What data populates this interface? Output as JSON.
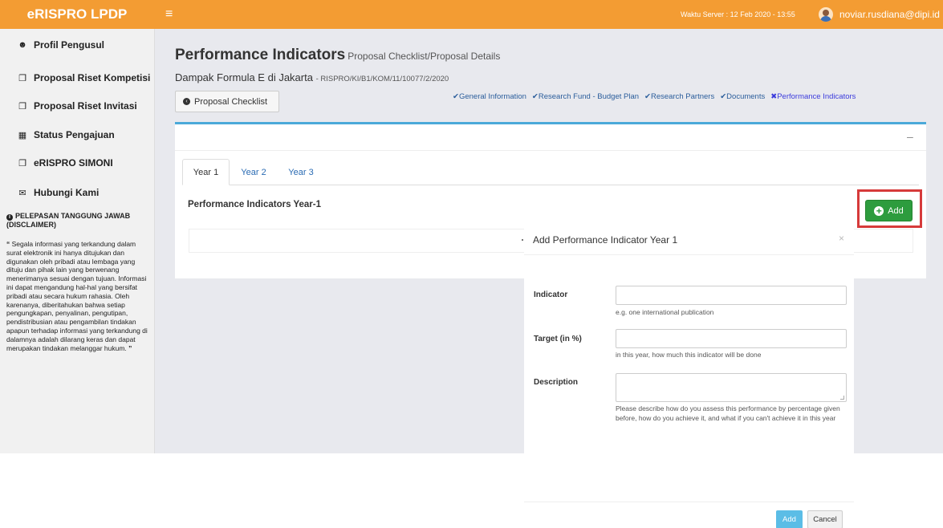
{
  "topbar": {
    "brand": "eRISPRO LPDP",
    "menu_icon": "hamburger-icon",
    "server_time": "Waktu Server : 12 Feb 2020 - 13:55",
    "user": "noviar.rusdiana@dipi.id",
    "color": "#f39c33"
  },
  "sidebar": {
    "items": [
      {
        "label": "Profil Pengusul",
        "icon": "users-icon"
      },
      {
        "label": "Proposal Riset Kompetisi",
        "icon": "copy-icon"
      },
      {
        "label": "Proposal Riset Invitasi",
        "icon": "copy-icon"
      },
      {
        "label": "Status Pengajuan",
        "icon": "grid-icon"
      },
      {
        "label": "eRISPRO SIMONI",
        "icon": "copy-icon"
      },
      {
        "label": "Hubungi Kami",
        "icon": "envelope-icon"
      }
    ],
    "disclaimer_title": "PELEPASAN TANGGUNG JAWAB (DISCLAIMER)",
    "disclaimer_text": "Segala informasi yang terkandung dalam surat elektronik ini hanya ditujukan dan digunakan oleh pribadi atau lembaga yang dituju dan pihak lain yang berwenang menerimanya sesuai dengan tujuan. Informasi ini dapat mengandung hal-hal yang bersifat pribadi atau secara hukum rahasia. Oleh karenanya, diberitahukan bahwa setiap pengungkapan, penyalinan, pengutipan, pendistribusian atau pengambilan tindakan apapun terhadap informasi yang terkandung di dalamnya adalah dilarang keras dan dapat merupakan tindakan melanggar hukum."
  },
  "main": {
    "title": "Performance Indicators",
    "subtitle": "Proposal Checklist/Proposal Details",
    "proposal_name": "Dampak Formula E di Jakarta",
    "proposal_code": "- RISPRO/KI/B1/KOM/11/10077/2/2020",
    "checklist_button": "Proposal Checklist",
    "steps": [
      "✔General Information",
      "✔Research Fund - Budget Plan",
      "✔Research Partners",
      "✔Documents"
    ],
    "active_step": "✖Performance Indicators",
    "collapse_symbol": "–",
    "tabs": [
      "Year 1",
      "Year 2",
      "Year 3"
    ],
    "section_heading": "Performance Indicators Year-1",
    "add_button": "Add"
  },
  "modal": {
    "title": "Add Performance Indicator Year 1",
    "close": "×",
    "fields": [
      {
        "label": "Indicator",
        "value": "",
        "help": "e.g. one international publication"
      },
      {
        "label": "Target (in %)",
        "value": "",
        "help": "in this year, how much this indicator will be done"
      },
      {
        "label": "Description",
        "value": "",
        "help": "Please describe how do you assess this performance by percentage given before, how do you achieve it, and what if you can't achieve it in this year"
      }
    ],
    "add_button": "Add",
    "cancel_button": "Cancel"
  }
}
